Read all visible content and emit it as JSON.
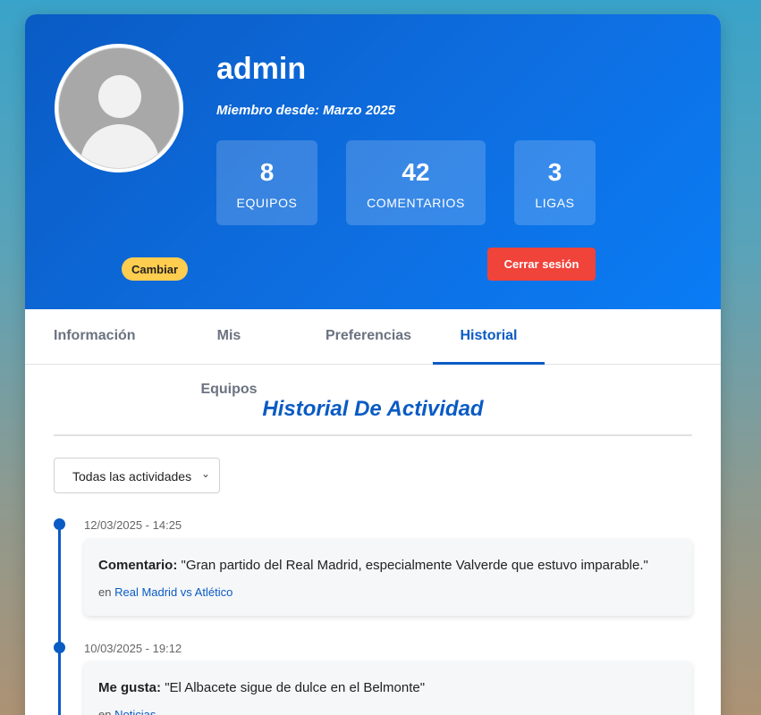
{
  "profile": {
    "username": "admin",
    "member_since": "Miembro desde: Marzo 2025",
    "change_button": "Cambiar",
    "logout_button": "Cerrar sesión",
    "stats": [
      {
        "value": "8",
        "label": "EQUIPOS"
      },
      {
        "value": "42",
        "label": "COMENTARIOS"
      },
      {
        "value": "3",
        "label": "LIGAS"
      }
    ]
  },
  "tabs": [
    {
      "label": "Información",
      "active": false
    },
    {
      "label": "Mis Equipos",
      "active": false
    },
    {
      "label": "Preferencias",
      "active": false
    },
    {
      "label": "Historial",
      "active": true
    }
  ],
  "history": {
    "title": "Historial De Actividad",
    "filter_selected": "Todas las actividades",
    "entries": [
      {
        "date": "12/03/2025 - 14:25",
        "type": "Comentario:",
        "text": "\"Gran partido del Real Madrid, especialmente Valverde que estuvo imparable.\"",
        "prefix": "en",
        "link": "Real Madrid vs Atlético"
      },
      {
        "date": "10/03/2025 - 19:12",
        "type": "Me gusta:",
        "text": "\"El Albacete sigue de dulce en el Belmonte\"",
        "prefix": "en",
        "link": "Noticias"
      }
    ]
  },
  "colors": {
    "primary": "#0a5bc4",
    "logout": "#f0433a",
    "change": "#ffcd4f"
  }
}
